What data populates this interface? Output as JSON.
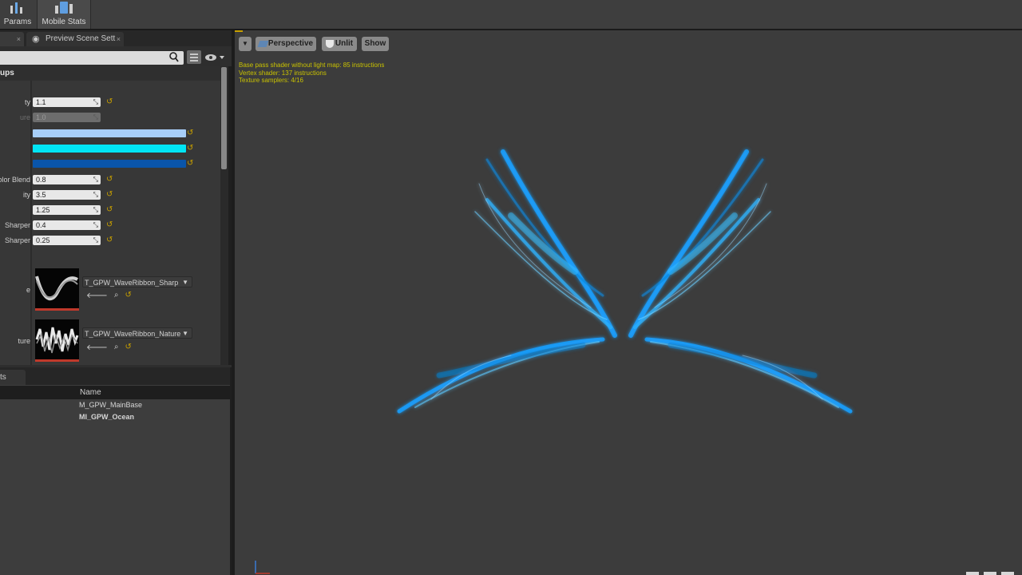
{
  "toolbar": {
    "params_label": "Params",
    "mobile_stats_label": "Mobile Stats"
  },
  "tabs": {
    "preview_scene_label": "Preview Scene Sett"
  },
  "details": {
    "group_label": "ups",
    "params": [
      {
        "label": "ty",
        "value": "1.1"
      },
      {
        "label": "ure",
        "value": "1.0"
      },
      {
        "label": "olor Blend",
        "value": "0.8"
      },
      {
        "label": "ity",
        "value": "3.5"
      },
      {
        "label": "",
        "value": "1.25"
      },
      {
        "label": "Sharper",
        "value": "0.4"
      },
      {
        "label": "Sharper",
        "value": "0.25"
      }
    ],
    "colors": [
      "#a7cef8",
      "#00e5f5",
      "#0a55aa"
    ],
    "textures": [
      {
        "label": "e",
        "name": "T_GPW_WaveRibbon_Sharp"
      },
      {
        "label": "ture",
        "name": "T_GPW_WaveRibbon_Nature"
      }
    ]
  },
  "list": {
    "tab_label": "ts",
    "column_name": "Name",
    "rows": [
      "M_GPW_MainBase",
      "MI_GPW_Ocean"
    ]
  },
  "viewport": {
    "view_mode": "Perspective",
    "lit_mode": "Unlit",
    "show_label": "Show",
    "stats": [
      "Base pass shader without light map: 85 instructions",
      "Vertex shader: 137 instructions",
      "Texture samplers: 4/16"
    ]
  }
}
